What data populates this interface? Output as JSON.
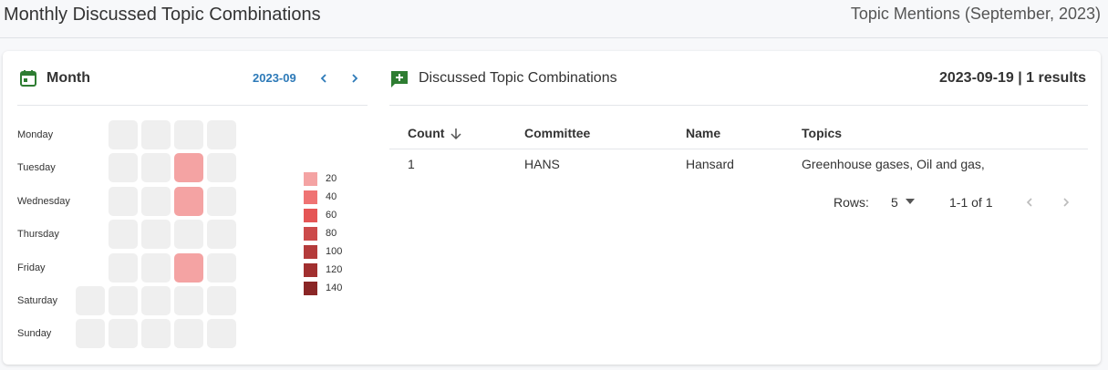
{
  "page": {
    "title": "Monthly Discussed Topic Combinations",
    "subtitle": "Topic Mentions (September, 2023)"
  },
  "month_panel": {
    "title": "Month",
    "month": "2023-09",
    "prev_icon": "chevron-left-icon",
    "next_icon": "chevron-right-icon",
    "calendar_icon": "calendar-icon",
    "days": [
      "Monday",
      "Tuesday",
      "Wednesday",
      "Thursday",
      "Friday",
      "Saturday",
      "Sunday"
    ],
    "heatmap_rows": [
      [
        null,
        0,
        0,
        0,
        0
      ],
      [
        null,
        0,
        0,
        20,
        0
      ],
      [
        null,
        0,
        0,
        20,
        0
      ],
      [
        null,
        0,
        0,
        0,
        0
      ],
      [
        null,
        0,
        0,
        20,
        0
      ],
      [
        0,
        0,
        0,
        0,
        0
      ],
      [
        0,
        0,
        0,
        0,
        0
      ]
    ],
    "legend": [
      {
        "label": "20",
        "color": "#f4a3a3"
      },
      {
        "label": "40",
        "color": "#ef7373"
      },
      {
        "label": "60",
        "color": "#e55555"
      },
      {
        "label": "80",
        "color": "#cc4a4a"
      },
      {
        "label": "100",
        "color": "#b43b3b"
      },
      {
        "label": "120",
        "color": "#a12f2f"
      },
      {
        "label": "140",
        "color": "#8a2626"
      }
    ],
    "empty_color": "#efefef"
  },
  "topics_panel": {
    "title": "Discussed Topic Combinations",
    "result": "2023-09-19 | 1 results",
    "icon": "add-comment-icon",
    "columns": [
      "Count",
      "Committee",
      "Name",
      "Topics"
    ],
    "sort_icon": "arrow-down-icon",
    "rows": [
      {
        "count": "1",
        "committee": "HANS",
        "name": "Hansard",
        "topics": "Greenhouse gases, Oil and gas,"
      }
    ],
    "pagination": {
      "rows_label": "Rows:",
      "rows_value": "5",
      "range": "1-1 of 1"
    }
  },
  "colors": {
    "accent_green": "#2e7d32",
    "accent_blue": "#2d7ab8"
  }
}
